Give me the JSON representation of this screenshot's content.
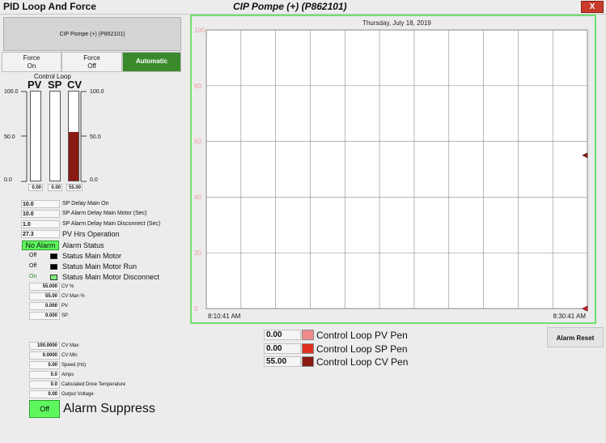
{
  "window": {
    "left_title": "PID Loop And Force",
    "center_title": "CIP Pompe (+) (P862101)",
    "close_label": "X"
  },
  "header_button": "CIP Pompe (+) (P862101)",
  "modes": {
    "force_on": "Force\nOn",
    "force_off": "Force\nOff",
    "automatic": "Automatic"
  },
  "control_loop": {
    "title": "Control Loop",
    "bars": [
      {
        "label": "PV",
        "value": 0.0,
        "display": "0.00"
      },
      {
        "label": "SP",
        "value": 0.0,
        "display": "0.00"
      },
      {
        "label": "CV",
        "value": 55.0,
        "display": "55.00"
      }
    ],
    "scale": {
      "top": "100.0",
      "mid": "50.0",
      "bottom": "0.0",
      "max": 100
    }
  },
  "params": [
    {
      "value": "10.0",
      "label": "SP Delay Main On"
    },
    {
      "value": "10.0",
      "label": "SP Alarm Delay Main Motor (Sec)"
    },
    {
      "value": "1.0",
      "label": "SP Alarm Delay Main Disconnect (Sec)"
    },
    {
      "value": "27.3",
      "label": "PV Hrs Operation"
    }
  ],
  "alarm": {
    "badge": "No Alarm",
    "label": "Alarm Status"
  },
  "statuses": [
    {
      "value": "Off",
      "label": "Status Main Motor",
      "indicator": "#000000",
      "value_color": "#111111"
    },
    {
      "value": "Off",
      "label": "Status Main Motor Run",
      "indicator": "#000000",
      "value_color": "#111111"
    },
    {
      "value": "On",
      "label": "Status Main Motor Disconnect",
      "indicator": "#7cf07c",
      "value_color": "#2a8a2a"
    }
  ],
  "readouts_a": [
    {
      "value": "55.000",
      "label": "CV %"
    },
    {
      "value": "55.00",
      "label": "CV Man %"
    },
    {
      "value": "0.000",
      "label": "PV"
    },
    {
      "value": "0.000",
      "label": "SP"
    }
  ],
  "readouts_b": [
    {
      "value": "100.0000",
      "label": "CV Max"
    },
    {
      "value": "0.0000",
      "label": "CV Min"
    },
    {
      "value": "0.00",
      "label": "Speed (Hz)"
    },
    {
      "value": "0.0",
      "label": "Amps"
    },
    {
      "value": "0.0",
      "label": "Calculated Drive Temperature"
    },
    {
      "value": "0.00",
      "label": "Output Voltage"
    }
  ],
  "suppress": {
    "button": "Off",
    "label": "Alarm Suppress"
  },
  "chart_data": {
    "type": "line",
    "title": "Thursday, July 18, 2019",
    "x_start": "8:10:41 AM",
    "x_end": "8:30:41 AM",
    "ylim": [
      0,
      100
    ],
    "y_ticks": [
      "0",
      "20",
      "40",
      "60",
      "80",
      "100"
    ],
    "grid": true,
    "series": [
      {
        "name": "Control Loop PV Pen",
        "current": 0.0,
        "color": "#f08080"
      },
      {
        "name": "Control Loop SP Pen",
        "current": 0.0,
        "color": "#e02020"
      },
      {
        "name": "Control Loop CV Pen",
        "current": 55.0,
        "color": "#8b1a12"
      }
    ]
  },
  "pens": [
    {
      "value": "0.00",
      "label": "Control Loop PV Pen",
      "color": "#f08c8c"
    },
    {
      "value": "0.00",
      "label": "Control Loop SP  Pen",
      "color": "#e03020"
    },
    {
      "value": "55.00",
      "label": "Control Loop CV Pen",
      "color": "#8b1a12"
    }
  ],
  "alarm_reset": "Alarm Reset"
}
